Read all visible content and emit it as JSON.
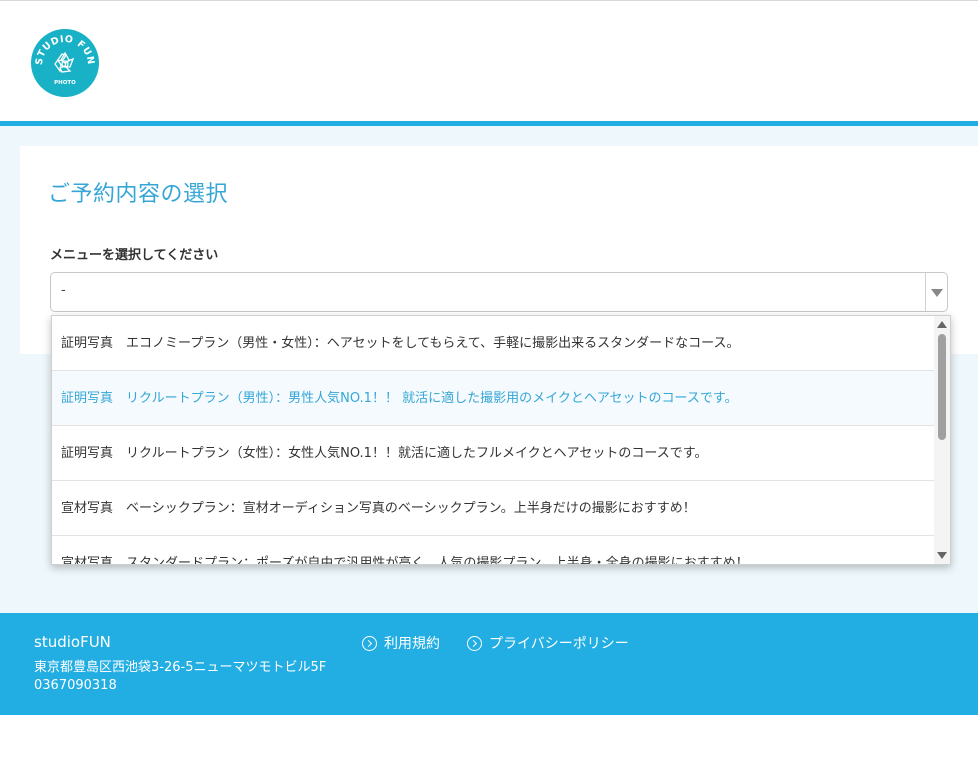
{
  "logo": {
    "brand": "STUDIO FUN",
    "sub": "PHOTO",
    "color": "#18b1c6"
  },
  "main": {
    "title": "ご予約内容の選択",
    "menu_label": "メニューを選択してください",
    "select": {
      "value": "-"
    },
    "options": [
      "証明写真　エコノミープラン（男性・女性）：ヘアセットをしてもらえて、手軽に撮影出来るスタンダードなコース。",
      "証明写真　リクルートプラン（男性）：男性人気NO.1！！ 就活に適した撮影用のメイクとヘアセットのコースです。",
      "証明写真　リクルートプラン（女性）：女性人気NO.1！！就活に適したフルメイクとヘアセットのコースです。",
      "宣材写真　ベーシックプラン：宣材オーディション写真のベーシックプラン。上半身だけの撮影におすすめ！",
      "宣材写真　スタンダードプラン：ポーズが自由で汎用性が高く、人気の撮影プラン。上半身・全身の撮影におすすめ！"
    ]
  },
  "footer": {
    "name": "studioFUN",
    "address": "東京都豊島区西池袋3-26-5ニューマツモトビル5F",
    "phone": "0367090318",
    "links": {
      "terms": "利用規約",
      "privacy": "プライバシーポリシー"
    }
  },
  "colors": {
    "accent": "#22aee3",
    "title": "#35a6d6",
    "page_bg": "#eef8fc",
    "footer_bg": "#22aee3"
  }
}
